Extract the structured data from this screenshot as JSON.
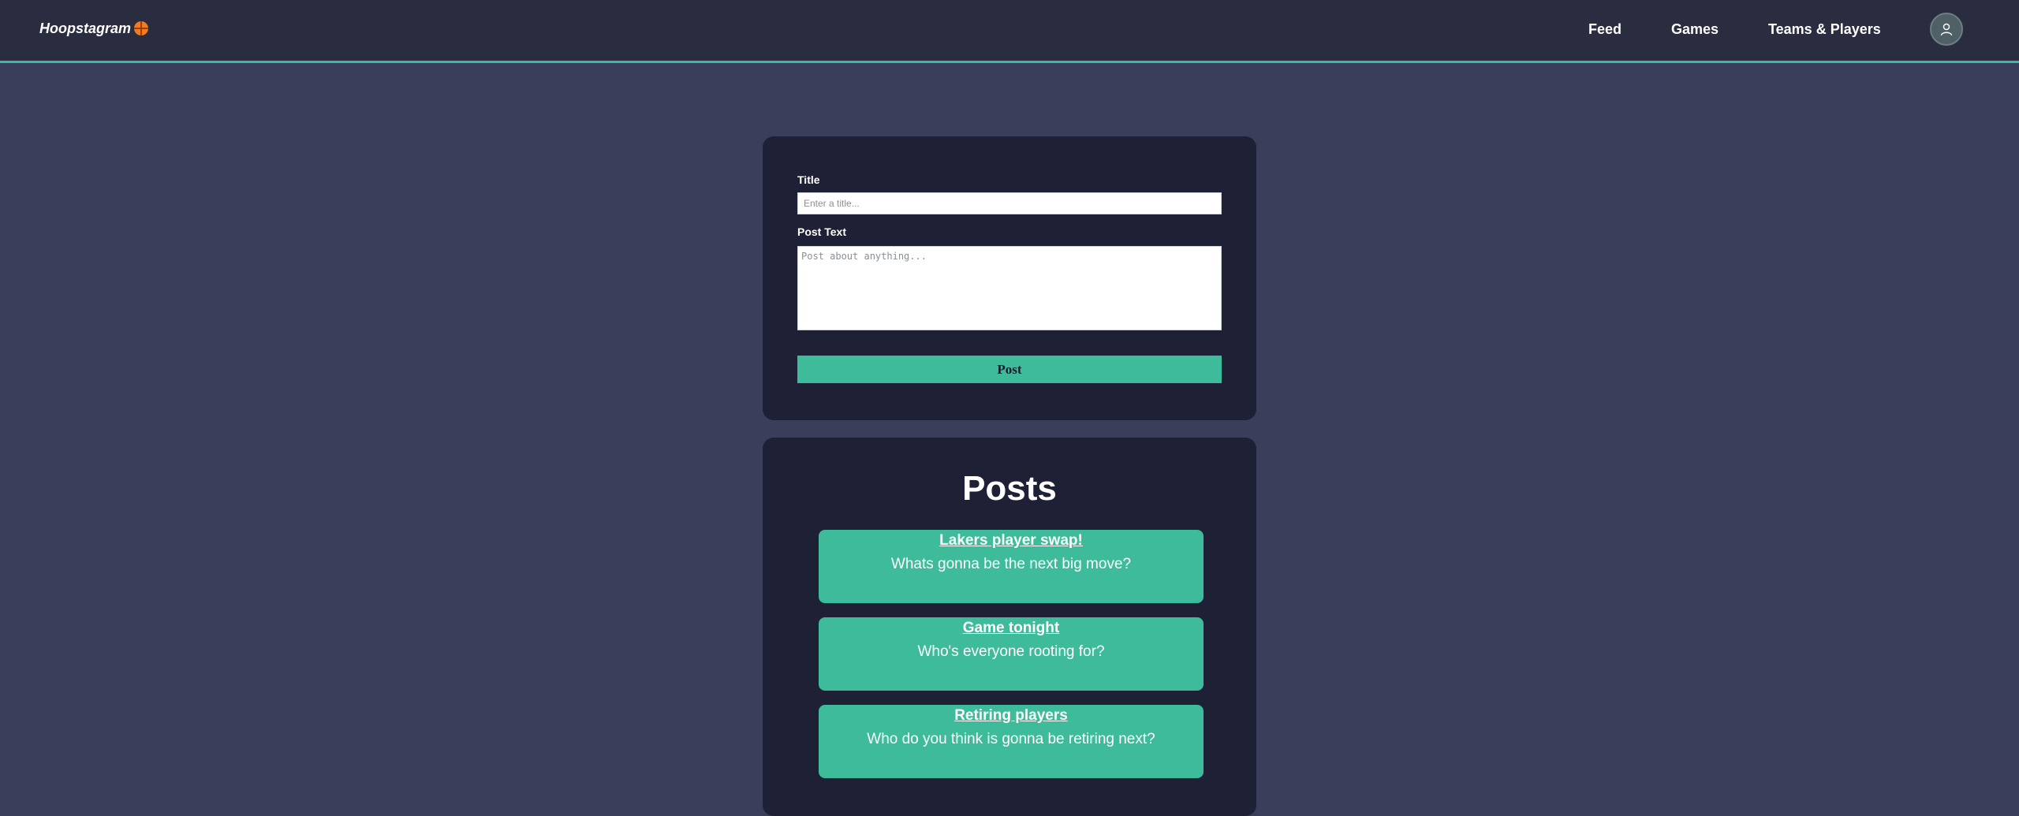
{
  "navbar": {
    "brand": "Hoopstagram",
    "brand_icon": "basketball-icon",
    "links": [
      "Feed",
      "Games",
      "Teams & Players"
    ],
    "avatar_icon": "user-icon"
  },
  "form": {
    "title_label": "Title",
    "title_placeholder": "Enter a title...",
    "title_value": "",
    "text_label": "Post Text",
    "text_placeholder": "Post about anything...",
    "text_value": "",
    "submit_label": "Post"
  },
  "posts": {
    "heading": "Posts",
    "items": [
      {
        "title": "Lakers player swap!",
        "body": "Whats gonna be the next big move?"
      },
      {
        "title": "Game tonight",
        "body": "Who's everyone rooting for?"
      },
      {
        "title": "Retiring players",
        "body": "Who do you think is gonna be retiring next?"
      }
    ]
  },
  "colors": {
    "background": "#3b3e5b",
    "navbar": "#2a2c40",
    "card": "#1e2036",
    "accent": "#3dbb9a",
    "ball": "#f47b20"
  }
}
